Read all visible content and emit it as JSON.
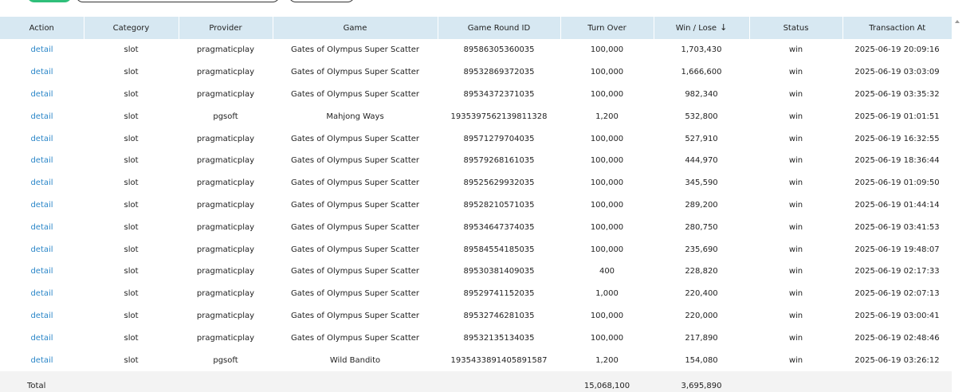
{
  "table": {
    "columns": [
      "Action",
      "Category",
      "Provider",
      "Game",
      "Game Round ID",
      "Turn Over",
      "Win / Lose",
      "Status",
      "Transaction At"
    ],
    "rows": [
      {
        "action": "detail",
        "category": "slot",
        "provider": "pragmaticplay",
        "game": "Gates of Olympus Super Scatter",
        "round_id": "89586305360035",
        "turn_over": "100,000",
        "win_lose": "1,703,430",
        "status": "win",
        "transaction_at": "2025-06-19 20:09:16"
      },
      {
        "action": "detail",
        "category": "slot",
        "provider": "pragmaticplay",
        "game": "Gates of Olympus Super Scatter",
        "round_id": "89532869372035",
        "turn_over": "100,000",
        "win_lose": "1,666,600",
        "status": "win",
        "transaction_at": "2025-06-19 03:03:09"
      },
      {
        "action": "detail",
        "category": "slot",
        "provider": "pragmaticplay",
        "game": "Gates of Olympus Super Scatter",
        "round_id": "89534372371035",
        "turn_over": "100,000",
        "win_lose": "982,340",
        "status": "win",
        "transaction_at": "2025-06-19 03:35:32"
      },
      {
        "action": "detail",
        "category": "slot",
        "provider": "pgsoft",
        "game": "Mahjong Ways",
        "round_id": "1935397562139811328",
        "turn_over": "1,200",
        "win_lose": "532,800",
        "status": "win",
        "transaction_at": "2025-06-19 01:01:51"
      },
      {
        "action": "detail",
        "category": "slot",
        "provider": "pragmaticplay",
        "game": "Gates of Olympus Super Scatter",
        "round_id": "89571279704035",
        "turn_over": "100,000",
        "win_lose": "527,910",
        "status": "win",
        "transaction_at": "2025-06-19 16:32:55"
      },
      {
        "action": "detail",
        "category": "slot",
        "provider": "pragmaticplay",
        "game": "Gates of Olympus Super Scatter",
        "round_id": "89579268161035",
        "turn_over": "100,000",
        "win_lose": "444,970",
        "status": "win",
        "transaction_at": "2025-06-19 18:36:44"
      },
      {
        "action": "detail",
        "category": "slot",
        "provider": "pragmaticplay",
        "game": "Gates of Olympus Super Scatter",
        "round_id": "89525629932035",
        "turn_over": "100,000",
        "win_lose": "345,590",
        "status": "win",
        "transaction_at": "2025-06-19 01:09:50"
      },
      {
        "action": "detail",
        "category": "slot",
        "provider": "pragmaticplay",
        "game": "Gates of Olympus Super Scatter",
        "round_id": "89528210571035",
        "turn_over": "100,000",
        "win_lose": "289,200",
        "status": "win",
        "transaction_at": "2025-06-19 01:44:14"
      },
      {
        "action": "detail",
        "category": "slot",
        "provider": "pragmaticplay",
        "game": "Gates of Olympus Super Scatter",
        "round_id": "89534647374035",
        "turn_over": "100,000",
        "win_lose": "280,750",
        "status": "win",
        "transaction_at": "2025-06-19 03:41:53"
      },
      {
        "action": "detail",
        "category": "slot",
        "provider": "pragmaticplay",
        "game": "Gates of Olympus Super Scatter",
        "round_id": "89584554185035",
        "turn_over": "100,000",
        "win_lose": "235,690",
        "status": "win",
        "transaction_at": "2025-06-19 19:48:07"
      },
      {
        "action": "detail",
        "category": "slot",
        "provider": "pragmaticplay",
        "game": "Gates of Olympus Super Scatter",
        "round_id": "89530381409035",
        "turn_over": "400",
        "win_lose": "228,820",
        "status": "win",
        "transaction_at": "2025-06-19 02:17:33"
      },
      {
        "action": "detail",
        "category": "slot",
        "provider": "pragmaticplay",
        "game": "Gates of Olympus Super Scatter",
        "round_id": "89529741152035",
        "turn_over": "1,000",
        "win_lose": "220,400",
        "status": "win",
        "transaction_at": "2025-06-19 02:07:13"
      },
      {
        "action": "detail",
        "category": "slot",
        "provider": "pragmaticplay",
        "game": "Gates of Olympus Super Scatter",
        "round_id": "89532746281035",
        "turn_over": "100,000",
        "win_lose": "220,000",
        "status": "win",
        "transaction_at": "2025-06-19 03:00:41"
      },
      {
        "action": "detail",
        "category": "slot",
        "provider": "pragmaticplay",
        "game": "Gates of Olympus Super Scatter",
        "round_id": "89532135134035",
        "turn_over": "100,000",
        "win_lose": "217,890",
        "status": "win",
        "transaction_at": "2025-06-19 02:48:46"
      },
      {
        "action": "detail",
        "category": "slot",
        "provider": "pgsoft",
        "game": "Wild Bandito",
        "round_id": "1935433891405891587",
        "turn_over": "1,200",
        "win_lose": "154,080",
        "status": "win",
        "transaction_at": "2025-06-19 03:26:12"
      }
    ],
    "total": {
      "label": "Total",
      "turn_over": "15,068,100",
      "win_lose": "3,695,890"
    },
    "sort": {
      "column": "Win / Lose",
      "direction": "desc",
      "icon": "arrow-down-icon"
    }
  },
  "colors": {
    "header_bg": "#d7e8f2",
    "link": "#2a86c8",
    "total_bg": "#f3f3f3",
    "primary_button": "#2fbf7a"
  }
}
